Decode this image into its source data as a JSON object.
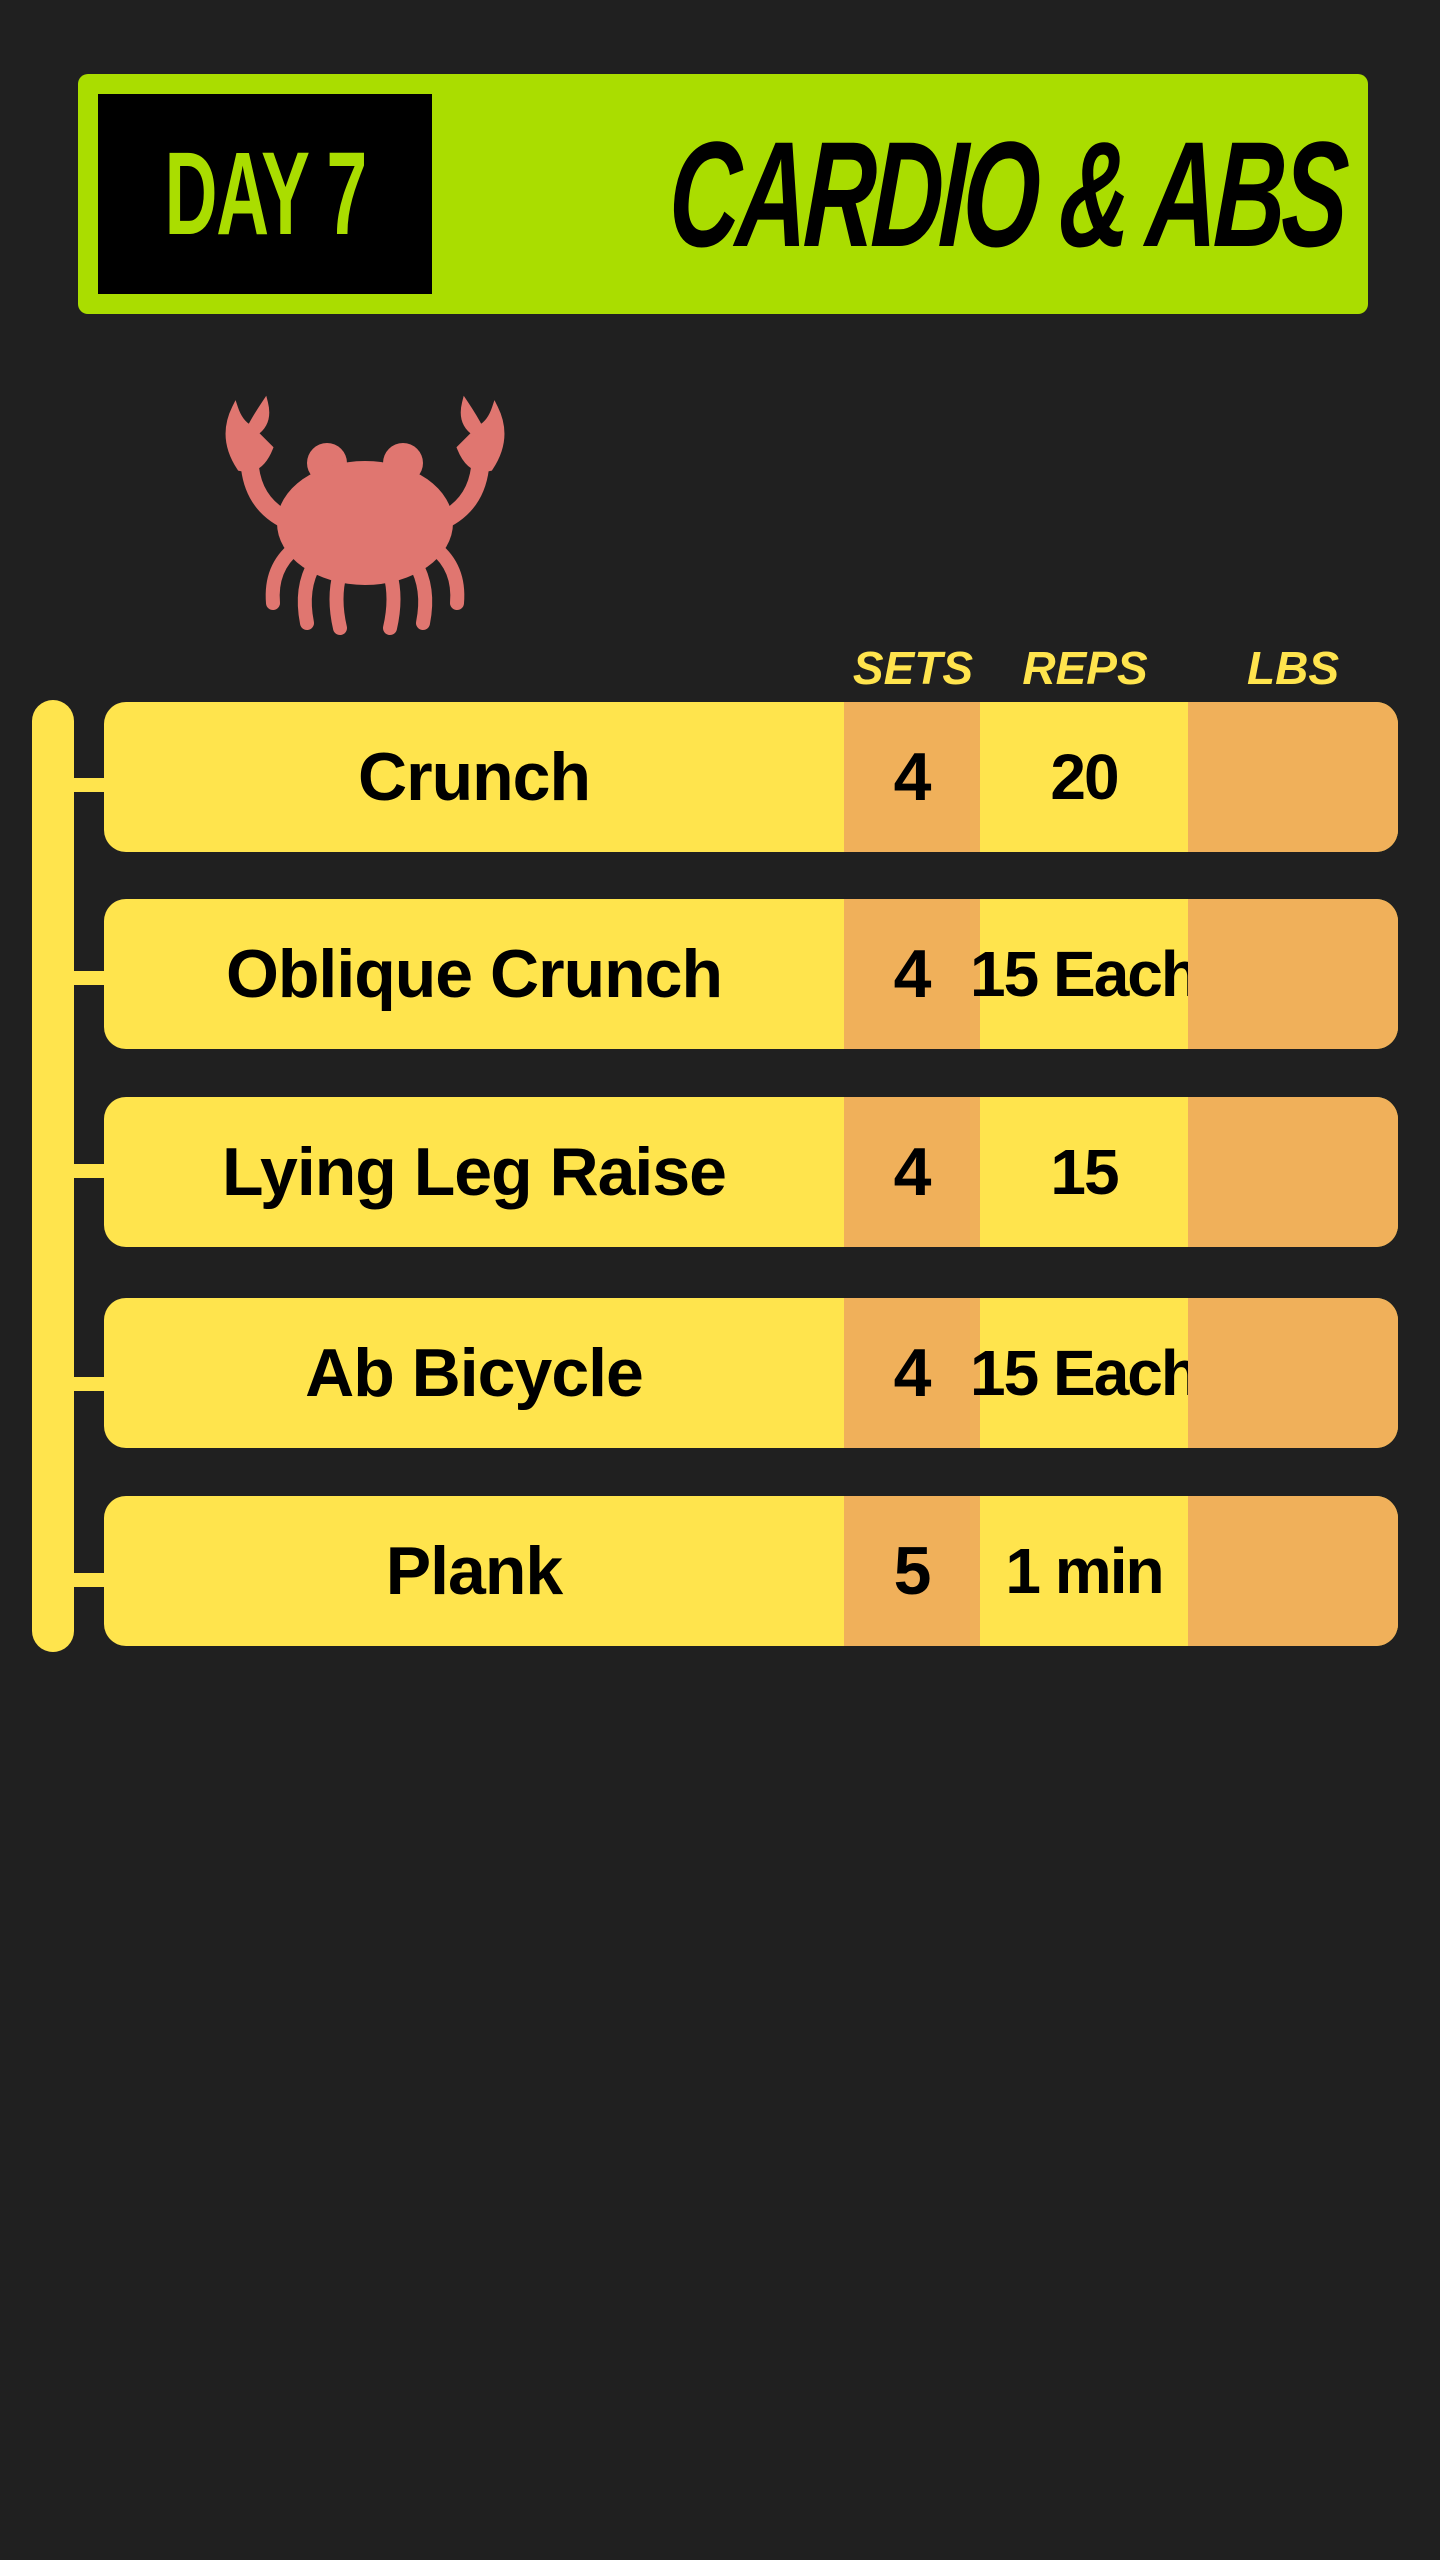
{
  "header": {
    "day_label": "DAY 7",
    "title": "CARDIO & ABS"
  },
  "icon": {
    "name": "crab-icon",
    "color": "#e07670"
  },
  "columns": {
    "sets": "SETS",
    "reps": "REPS",
    "lbs": "LBS"
  },
  "exercises": [
    {
      "name": "Crunch",
      "sets": "4",
      "reps": "20",
      "lbs": ""
    },
    {
      "name": "Oblique Crunch",
      "sets": "4",
      "reps": "15 Each",
      "lbs": ""
    },
    {
      "name": "Lying Leg Raise",
      "sets": "4",
      "reps": "15",
      "lbs": ""
    },
    {
      "name": "Ab Bicycle",
      "sets": "4",
      "reps": "15 Each",
      "lbs": ""
    },
    {
      "name": "Plank",
      "sets": "5",
      "reps": "1 min",
      "lbs": ""
    }
  ],
  "colors": {
    "background": "#202020",
    "banner": "#aadd00",
    "row": "#ffe44d",
    "accent_cell": "#f0b05a",
    "header_text": "#ffe44d"
  }
}
